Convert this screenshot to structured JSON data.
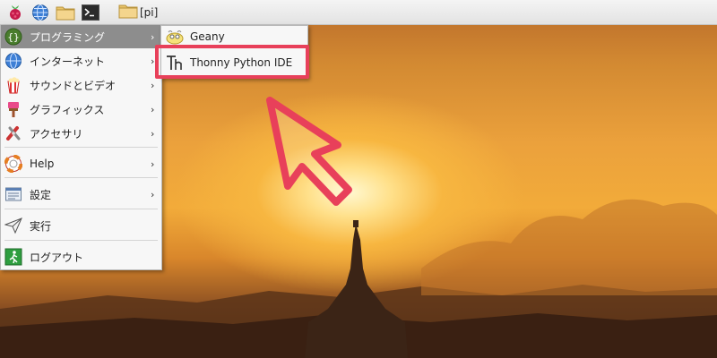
{
  "taskbar": {
    "launchers": [
      {
        "name": "raspberry-icon"
      },
      {
        "name": "globe-icon"
      },
      {
        "name": "folder-icon"
      },
      {
        "name": "terminal-icon"
      }
    ],
    "folder_label": "[pi]"
  },
  "main_menu": {
    "items": [
      {
        "label": "プログラミング",
        "icon": "code-braces-icon",
        "has_submenu": true,
        "active": true
      },
      {
        "label": "インターネット",
        "icon": "globe-icon",
        "has_submenu": true
      },
      {
        "label": "サウンドとビデオ",
        "icon": "popcorn-icon",
        "has_submenu": true
      },
      {
        "label": "グラフィックス",
        "icon": "paintbrush-icon",
        "has_submenu": true
      },
      {
        "label": "アクセサリ",
        "icon": "tools-icon",
        "has_submenu": true
      },
      {
        "label": "Help",
        "icon": "lifebuoy-icon",
        "has_submenu": true
      },
      {
        "label": "設定",
        "icon": "settings-panel-icon",
        "has_submenu": true
      },
      {
        "label": "実行",
        "icon": "paper-plane-icon",
        "has_submenu": false
      },
      {
        "label": "ログアウト",
        "icon": "exit-icon",
        "has_submenu": false
      }
    ]
  },
  "sub_menu": {
    "items": [
      {
        "label": "Geany",
        "icon": "geany-icon"
      },
      {
        "label": "Thonny Python IDE",
        "icon": "thonny-icon"
      }
    ]
  },
  "colors": {
    "highlight": "#e8405a",
    "menu_active": "#8d8d8d"
  }
}
